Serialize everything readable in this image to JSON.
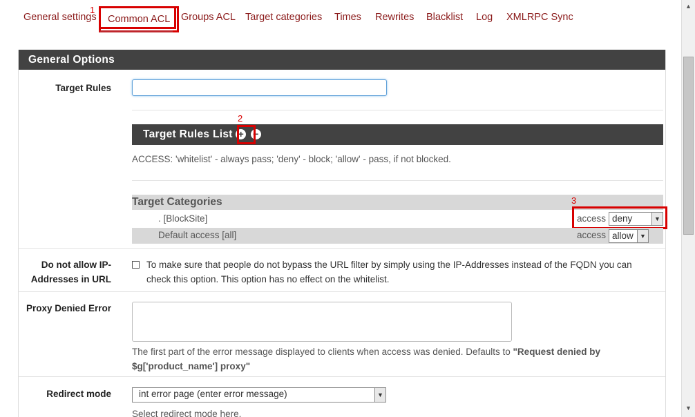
{
  "tabs": [
    {
      "label": "General settings"
    },
    {
      "label": "Common ACL"
    },
    {
      "label": "Groups ACL"
    },
    {
      "label": "Target categories"
    },
    {
      "label": "Times"
    },
    {
      "label": "Rewrites"
    },
    {
      "label": "Blacklist"
    },
    {
      "label": "Log"
    },
    {
      "label": "XMLRPC Sync"
    }
  ],
  "annotations": {
    "n1": "1",
    "n2": "2",
    "n3": "3"
  },
  "panel": {
    "title": "General Options"
  },
  "target_rules": {
    "label": "Target Rules",
    "value": "",
    "list_title": "Target Rules List",
    "add_icon": "plus-circle-icon",
    "remove_icon": "minus-circle-icon",
    "access_help": "ACCESS: 'whitelist' - always pass; 'deny' - block; 'allow' - pass, if not blocked."
  },
  "target_categories": {
    "title": "Target Categories",
    "rows": [
      {
        "name": ". [BlockSite]",
        "access_label": "access",
        "value": "deny"
      },
      {
        "name": "Default access [all]",
        "access_label": "access",
        "value": "allow"
      }
    ]
  },
  "ip_addresses": {
    "label_line1": "Do not allow IP-",
    "label_line2": "Addresses in URL",
    "checked": false,
    "text_line1": "To make sure that people do not bypass the URL filter by simply using the IP-Addresses instead of the FQDN you can",
    "text_line2": "check this option. This option has no effect on the whitelist."
  },
  "proxy_denied": {
    "label": "Proxy Denied Error",
    "value": "",
    "help_prefix": "The first part of the error message displayed to clients when access was denied. Defaults to ",
    "help_bold1": "\"Request denied by",
    "help_bold2": "$g['product_name'] proxy\""
  },
  "redirect_mode": {
    "label": "Redirect mode",
    "value": "int error page (enter error message)",
    "help": "Select redirect mode here."
  }
}
